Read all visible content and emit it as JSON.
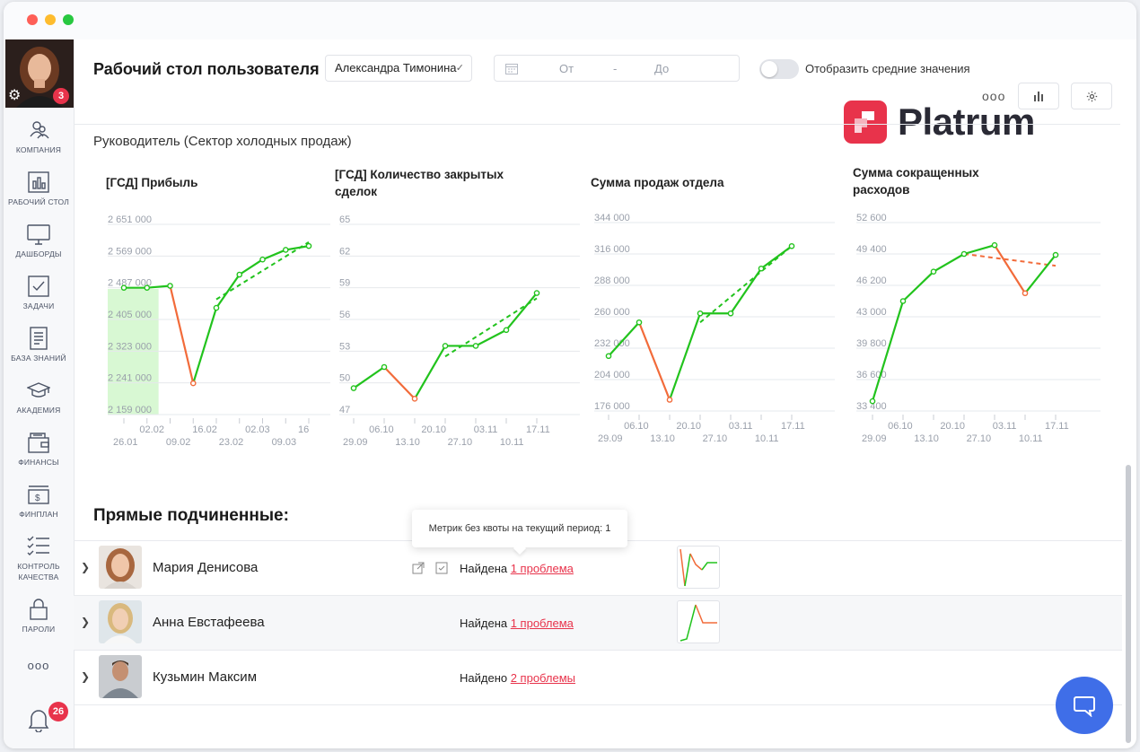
{
  "header": {
    "title": "Рабочий стол пользователя",
    "user_select": "Александра Тимонина",
    "date_from_placeholder": "От",
    "date_dash": "-",
    "date_to_placeholder": "До",
    "toggle_label": "Отобразить средние значения",
    "more_label": "ooo"
  },
  "logo": {
    "text": "Platrum",
    "color": "#e8334b"
  },
  "sidebar": {
    "photo_badge": "3",
    "bell_badge": "26",
    "more_label": "ooo",
    "items": [
      {
        "label": "КОМПАНИЯ",
        "icon": "company-icon"
      },
      {
        "label": "РАБОЧИЙ СТОЛ",
        "icon": "dashboard-bars-icon"
      },
      {
        "label": "ДАШБОРДЫ",
        "icon": "monitor-icon"
      },
      {
        "label": "ЗАДАЧИ",
        "icon": "checkbox-icon"
      },
      {
        "label": "БАЗА ЗНАНИЙ",
        "icon": "document-icon"
      },
      {
        "label": "АКАДЕМИЯ",
        "icon": "graduation-cap-icon"
      },
      {
        "label": "ФИНАНСЫ",
        "icon": "wallet-icon"
      },
      {
        "label": "ФИНПЛАН",
        "icon": "money-icon"
      },
      {
        "label": "КОНТРОЛЬ",
        "label2": "КАЧЕСТВА",
        "icon": "checklist-icon"
      },
      {
        "label": "ПАРОЛИ",
        "icon": "lock-icon"
      }
    ]
  },
  "role_title": "Руководитель (Сектор холодных продаж)",
  "colors": {
    "up": "#22c31d",
    "down": "#f26b3a",
    "accent": "#e8334b",
    "chat": "#3f6ee8"
  },
  "chart_data": [
    {
      "type": "line",
      "title": "[ГСД] Прибыль",
      "yticks": [
        "2 651 000",
        "2 569 000",
        "2 487 000",
        "2 405 000",
        "2 323 000",
        "2 241 000",
        "2 159 000"
      ],
      "ylim": [
        2159000,
        2651000
      ],
      "xticks_bottom": [
        "26.01",
        "09.02",
        "23.02",
        "09.03"
      ],
      "xticks_top": [
        "02.02",
        "16.02",
        "02.03",
        "16"
      ],
      "values": [
        2487000,
        2487000,
        2492000,
        2240000,
        2435000,
        2521000,
        2560000,
        2585000,
        2595000
      ],
      "trend": [
        2457000,
        2605000
      ],
      "highlight_band": [
        0,
        1.5
      ]
    },
    {
      "type": "line",
      "title": "[ГСД] Количество закрытых сделок",
      "yticks": [
        "65",
        "62",
        "59",
        "56",
        "53",
        "50",
        "47"
      ],
      "ylim": [
        47,
        65
      ],
      "xticks_bottom": [
        "29.09",
        "13.10",
        "27.10",
        "10.11"
      ],
      "xticks_top": [
        "06.10",
        "20.10",
        "03.11",
        "17.11"
      ],
      "values": [
        49.5,
        51.5,
        48.5,
        53.5,
        53.5,
        55,
        58.5
      ],
      "trend": [
        52.5,
        58
      ]
    },
    {
      "type": "line",
      "title": "Сумма продаж отдела",
      "yticks": [
        "344 000",
        "316 000",
        "288 000",
        "260 000",
        "232 000",
        "204 000",
        "176 000"
      ],
      "ylim": [
        176000,
        344000
      ],
      "xticks_bottom": [
        "29.09",
        "13.10",
        "27.10",
        "10.11"
      ],
      "xticks_top": [
        "06.10",
        "20.10",
        "03.11",
        "17.11"
      ],
      "values": [
        225000,
        255000,
        186000,
        263000,
        263000,
        303000,
        323000
      ],
      "trend": [
        255000,
        323000
      ]
    },
    {
      "type": "line",
      "title": "Сумма сокращенных расходов",
      "yticks": [
        "52 600",
        "49 400",
        "46 200",
        "43 000",
        "39 800",
        "36 600",
        "33 400"
      ],
      "ylim": [
        33400,
        52600
      ],
      "xticks_bottom": [
        "29.09",
        "13.10",
        "27.10",
        "10.11"
      ],
      "xticks_top": [
        "06.10",
        "20.10",
        "03.11",
        "17.11"
      ],
      "values": [
        34400,
        44600,
        47600,
        49400,
        50300,
        45400,
        49300
      ],
      "trend_red": [
        49400,
        48200
      ]
    }
  ],
  "subordinates": {
    "title": "Прямые подчиненные:",
    "tooltip": "Метрик без квоты на текущий период: 1",
    "rows": [
      {
        "name": "Мария Денисова",
        "status": "Найдена ",
        "link": "1 проблема",
        "has_actions": true
      },
      {
        "name": "Анна Евстафеева",
        "status": "Найдена ",
        "link": "1 проблема",
        "has_actions": false
      },
      {
        "name": "Кузьмин Максим",
        "status": "Найдено ",
        "link": "2 проблемы",
        "has_actions": false
      }
    ]
  }
}
